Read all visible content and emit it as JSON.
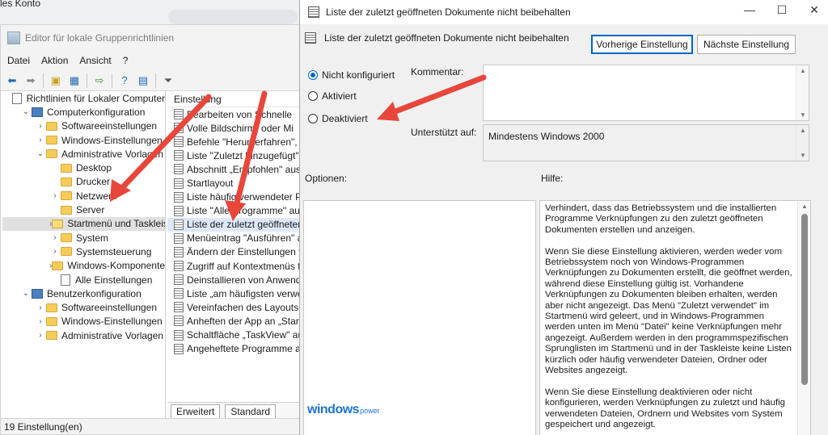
{
  "background": {
    "partial_text": "les Konto"
  },
  "gpo_window": {
    "title": "Editor für lokale Gruppenrichtlinien",
    "menu": [
      "Datei",
      "Aktion",
      "Ansicht",
      "?"
    ],
    "tree": [
      {
        "label": "Richtlinien für Lokaler Computer",
        "level": 0,
        "icon": "doc-icon",
        "exp": ""
      },
      {
        "label": "Computerkonfiguration",
        "level": 1,
        "icon": "computer-icon",
        "exp": "v"
      },
      {
        "label": "Softwareeinstellungen",
        "level": 2,
        "icon": "folder-icon",
        "exp": ">"
      },
      {
        "label": "Windows-Einstellungen",
        "level": 2,
        "icon": "folder-icon",
        "exp": ">"
      },
      {
        "label": "Administrative Vorlagen",
        "level": 2,
        "icon": "folder-icon",
        "exp": "v"
      },
      {
        "label": "Desktop",
        "level": 3,
        "icon": "folder-icon",
        "exp": ""
      },
      {
        "label": "Drucker",
        "level": 3,
        "icon": "folder-icon",
        "exp": ""
      },
      {
        "label": "Netzwerk",
        "level": 3,
        "icon": "folder-icon",
        "exp": ">"
      },
      {
        "label": "Server",
        "level": 3,
        "icon": "folder-icon",
        "exp": ""
      },
      {
        "label": "Startmenü und Taskleist",
        "level": 3,
        "icon": "folder-open-icon",
        "exp": ">",
        "selected": true
      },
      {
        "label": "System",
        "level": 3,
        "icon": "folder-icon",
        "exp": ">"
      },
      {
        "label": "Systemsteuerung",
        "level": 3,
        "icon": "folder-icon",
        "exp": ">"
      },
      {
        "label": "Windows-Komponenten",
        "level": 3,
        "icon": "folder-icon",
        "exp": ">"
      },
      {
        "label": "Alle Einstellungen",
        "level": 3,
        "icon": "doc-icon",
        "exp": ""
      },
      {
        "label": "Benutzerkonfiguration",
        "level": 1,
        "icon": "computer-icon",
        "exp": "v"
      },
      {
        "label": "Softwareeinstellungen",
        "level": 2,
        "icon": "folder-icon",
        "exp": ">"
      },
      {
        "label": "Windows-Einstellungen",
        "level": 2,
        "icon": "folder-icon",
        "exp": ">"
      },
      {
        "label": "Administrative Vorlagen",
        "level": 2,
        "icon": "folder-icon",
        "exp": ">"
      }
    ],
    "list_header": "Einstellung",
    "list": [
      "Bearbeiten von Schnelle",
      "Volle Bildschirm- oder Mi",
      "Befehle \"Herunterfahren\", \"N",
      "Liste \"Zuletzt hinzugefügt\" a",
      "Abschnitt „Empfohlen\" aus d",
      "Startlayout",
      "Liste häufig verwendeter Pro",
      "Liste \"Alle Programme\" aus d",
      "Liste der zuletzt geöffneten D",
      "Menüeintrag \"Ausführen\" au",
      "Ändern der Einstellungen fü",
      "Zugriff auf Kontextmenüs fü",
      "Deinstallieren von Anwendu",
      "Liste „am häufigsten verwen",
      "Vereinfachen des Layouts fü",
      "Anheften der App an „Start\"",
      "Schaltfläche „TaskView\" aus",
      "Angeheftete Programme aus"
    ],
    "selected_list_index": 8,
    "tabs": [
      "Erweitert",
      "Standard"
    ],
    "status": "19 Einstellung(en)"
  },
  "dialog": {
    "title": "Liste der zuletzt geöffneten Dokumente nicht beibehalten",
    "setting_name": "Liste der zuletzt geöffneten Dokumente nicht beibehalten",
    "prev_button": "Vorherige Einstellung",
    "next_button": "Nächste Einstellung",
    "radios": [
      "Nicht konfiguriert",
      "Aktiviert",
      "Deaktiviert"
    ],
    "selected_radio": 0,
    "comment_label": "Kommentar:",
    "supported_label": "Unterstützt auf:",
    "supported_value": "Mindestens Windows 2000",
    "options_label": "Optionen:",
    "help_label": "Hilfe:",
    "help_paragraphs": [
      "Verhindert, dass das Betriebssystem und die installierten Programme Verknüpfungen zu den zuletzt geöffneten Dokumenten erstellen und anzeigen.",
      "Wenn Sie diese Einstellung aktivieren, werden weder vom Betriebssystem noch von Windows-Programmen Verknüpfungen zu Dokumenten erstellt, die geöffnet werden, während diese Einstellung gültig ist. Vorhandene Verknüpfungen zu Dokumenten bleiben erhalten, werden aber nicht angezeigt. Das Menü \"Zuletzt verwendet\" im Startmenü wird geleert, und in Windows-Programmen werden unten im Menü \"Datei\" keine Verknüpfungen mehr angezeigt. Außerdem werden in den programmspezifischen Sprunglisten im Startmenü und in der Taskleiste keine Listen kürzlich oder häufig verwendeter Dateien, Ordner oder Websites angezeigt.",
      "Wenn Sie diese Einstellung deaktivieren oder nicht konfigurieren, werden Verknüpfungen zu zuletzt und häufig verwendeten Dateien, Ordnern und Websites vom System gespeichert und angezeigt."
    ],
    "watermark_main": "windows",
    "watermark_sub": "power"
  },
  "colors": {
    "arrow": "#e8463b",
    "accent": "#0067c0"
  }
}
